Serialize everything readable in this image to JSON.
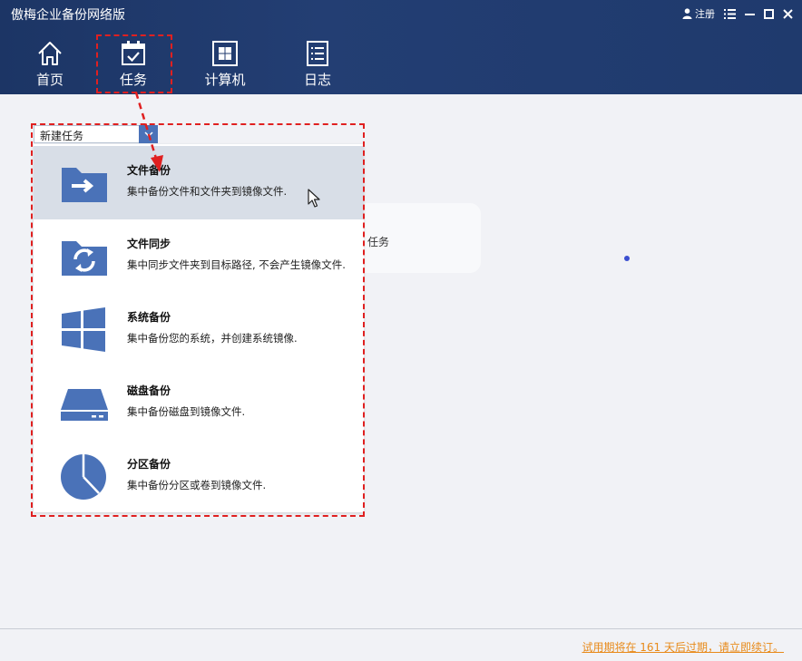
{
  "window": {
    "title": "傲梅企业备份网络版",
    "register_label": "注册"
  },
  "nav": {
    "items": [
      {
        "label": "首页",
        "icon": "home-icon"
      },
      {
        "label": "任务",
        "icon": "task-calendar-icon",
        "selected": true
      },
      {
        "label": "计算机",
        "icon": "windows-computer-icon"
      },
      {
        "label": "日志",
        "icon": "log-list-icon"
      }
    ]
  },
  "dropdown": {
    "value": "新建任务",
    "options": [
      {
        "title": "文件备份",
        "desc": "集中备份文件和文件夹到镜像文件.",
        "icon": "folder-arrow-icon",
        "hovered": true
      },
      {
        "title": "文件同步",
        "desc": "集中同步文件夹到目标路径, 不会产生镜像文件.",
        "icon": "folder-sync-icon"
      },
      {
        "title": "系统备份",
        "desc": "集中备份您的系统，并创建系统镜像.",
        "icon": "windows-logo-icon"
      },
      {
        "title": "磁盘备份",
        "desc": "集中备份磁盘到镜像文件.",
        "icon": "disk-drive-icon"
      },
      {
        "title": "分区备份",
        "desc": "集中备份分区或卷到镜像文件.",
        "icon": "pie-partition-icon"
      }
    ]
  },
  "background": {
    "card_text": "任务"
  },
  "footer": {
    "trial_text": "试用期将在 161 天后过期，请立即续订。"
  },
  "colors": {
    "header_bg": "#1f3a6d",
    "accent_blue": "#4a72b8",
    "highlight_red": "#e02020",
    "trial_orange": "#e88a1a"
  }
}
